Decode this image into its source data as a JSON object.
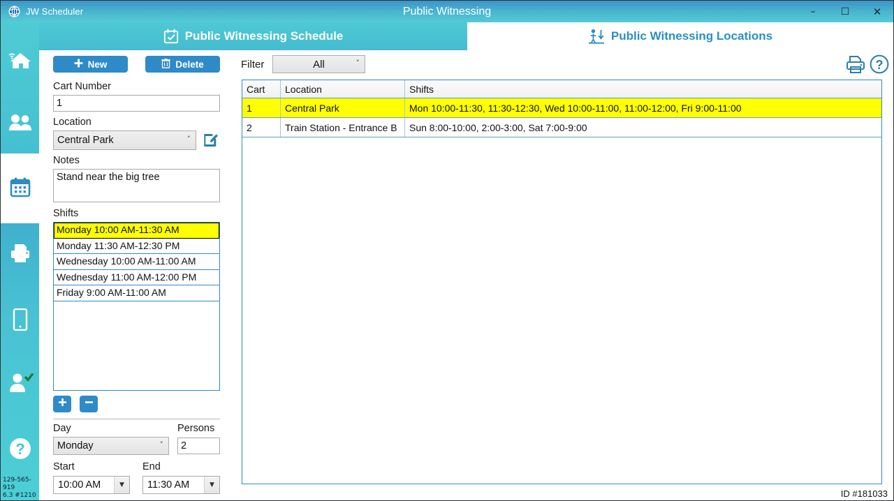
{
  "window": {
    "app_name": "JW Scheduler",
    "title": "Public Witnessing",
    "minimize": "–",
    "maximize": "☐",
    "close": "✕"
  },
  "sidebar": {
    "items": [
      {
        "name": "home",
        "icon": "home-wifi-icon"
      },
      {
        "name": "congregation",
        "icon": "people-icon"
      },
      {
        "name": "schedules",
        "icon": "calendar-icon"
      },
      {
        "name": "print",
        "icon": "printer-icon"
      },
      {
        "name": "mobile",
        "icon": "phone-icon"
      },
      {
        "name": "publisher",
        "icon": "person-check-icon"
      },
      {
        "name": "help",
        "icon": "question-circle-icon"
      }
    ],
    "version_line1": "129-565-919",
    "version_line2": "6.3 #1210"
  },
  "tabs": [
    {
      "label": "Public Witnessing Schedule",
      "icon": "calendar-check-icon",
      "active": true
    },
    {
      "label": "Public Witnessing Locations",
      "icon": "person-arrow-down-icon",
      "active": false
    }
  ],
  "form": {
    "new_label": "New",
    "delete_label": "Delete",
    "cart_number_label": "Cart Number",
    "cart_number_value": "1",
    "location_label": "Location",
    "location_value": "Central Park",
    "edit_icon": "edit-pencil-icon",
    "notes_label": "Notes",
    "notes_value": "Stand near the big tree",
    "shifts_label": "Shifts",
    "shifts": [
      {
        "text": "Monday 10:00 AM-11:30 AM",
        "selected": true
      },
      {
        "text": "Monday 11:30 AM-12:30 PM",
        "selected": false
      },
      {
        "text": "Wednesday 10:00 AM-11:00 AM",
        "selected": false
      },
      {
        "text": "Wednesday 11:00 AM-12:00 PM",
        "selected": false
      },
      {
        "text": "Friday 9:00 AM-11:00 AM",
        "selected": false
      }
    ],
    "add_shift_label": "+",
    "remove_shift_label": "–",
    "day_label": "Day",
    "day_value": "Monday",
    "persons_label": "Persons",
    "persons_value": "2",
    "start_label": "Start",
    "start_value": "10:00 AM",
    "end_label": "End",
    "end_value": "11:30 AM"
  },
  "right": {
    "filter_label": "Filter",
    "filter_value": "All",
    "print_icon": "printer-icon",
    "help_icon": "question-circle-icon",
    "columns": [
      "Cart",
      "Location",
      "Shifts"
    ],
    "rows": [
      {
        "cart": "1",
        "location": "Central Park",
        "shifts": "Mon 10:00-11:30, 11:30-12:30, Wed 10:00-11:00, 11:00-12:00, Fri 9:00-11:00",
        "selected": true
      },
      {
        "cart": "2",
        "location": "Train Station - Entrance B",
        "shifts": "Sun 8:00-10:00, 2:00-3:00, Sat 7:00-9:00",
        "selected": false
      }
    ],
    "id_tag": "ID #181033"
  },
  "colors": {
    "accent_blue": "#2e8bc8",
    "teal": "#4ac4d3",
    "highlight_yellow": "#ffff00",
    "tab_link": "#2a8fc4"
  }
}
